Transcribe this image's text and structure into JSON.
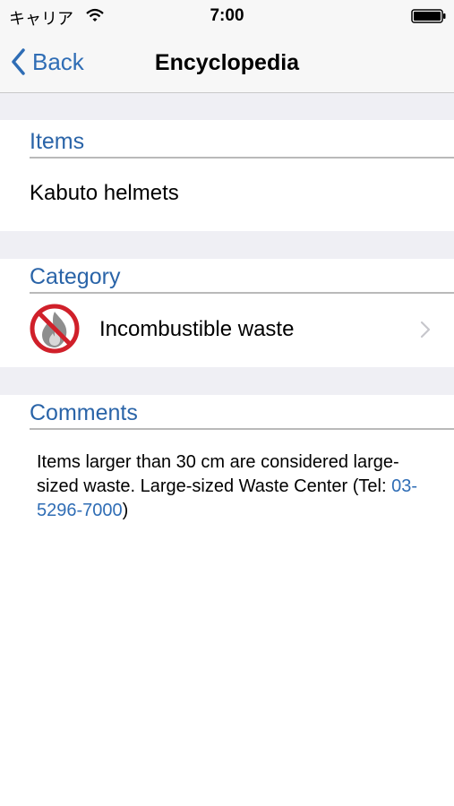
{
  "status_bar": {
    "carrier": "キャリア",
    "time": "7:00"
  },
  "nav": {
    "back_label": "Back",
    "title": "Encyclopedia"
  },
  "items": {
    "header": "Items",
    "value": "Kabuto helmets"
  },
  "category": {
    "header": "Category",
    "value": "Incombustible waste",
    "icon": "no-fire-icon"
  },
  "comments": {
    "header": "Comments",
    "text_before": "Items larger than 30 cm are considered large-sized waste. Large-sized Waste Center (Tel: ",
    "phone": "03-5296-7000",
    "text_after": ")"
  },
  "colors": {
    "accent": "#2f6db5",
    "section_header": "#2a64a8",
    "group_bg": "#efeff4",
    "prohibit_red": "#d0202a"
  }
}
